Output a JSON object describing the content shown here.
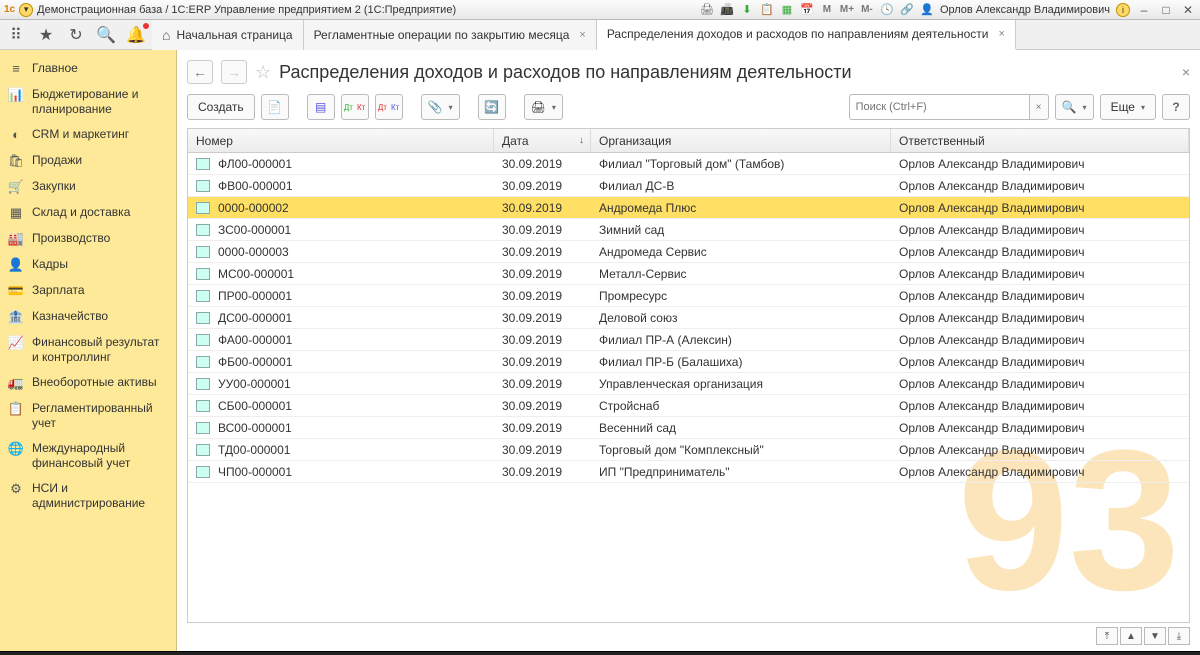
{
  "titlebar": {
    "app_title": "Демонстрационная база / 1С:ERP Управление предприятием 2  (1С:Предприятие)",
    "user": "Орлов Александр Владимирович"
  },
  "tabs": {
    "home": "Начальная страница",
    "tab1": "Регламентные операции по закрытию месяца",
    "tab2": "Распределения доходов и расходов по направлениям деятельности"
  },
  "sidebar": {
    "items": [
      {
        "icon": "≡",
        "label": "Главное"
      },
      {
        "icon": "📊",
        "label": "Бюджетирование и планирование"
      },
      {
        "icon": "◐",
        "label": "CRM и маркетинг"
      },
      {
        "icon": "🛍",
        "label": "Продажи"
      },
      {
        "icon": "🛒",
        "label": "Закупки"
      },
      {
        "icon": "▦",
        "label": "Склад и доставка"
      },
      {
        "icon": "🏭",
        "label": "Производство"
      },
      {
        "icon": "👤",
        "label": "Кадры"
      },
      {
        "icon": "💳",
        "label": "Зарплата"
      },
      {
        "icon": "🏦",
        "label": "Казначейство"
      },
      {
        "icon": "📈",
        "label": "Финансовый результат и контроллинг"
      },
      {
        "icon": "🚛",
        "label": "Внеоборотные активы"
      },
      {
        "icon": "📋",
        "label": "Регламентированный учет"
      },
      {
        "icon": "🌐",
        "label": "Международный финансовый учет"
      },
      {
        "icon": "⚙",
        "label": "НСИ и администрирование"
      }
    ]
  },
  "page": {
    "title": "Распределения доходов и расходов по направлениям деятельности",
    "create_btn": "Создать",
    "more_btn": "Еще",
    "search_placeholder": "Поиск (Ctrl+F)"
  },
  "table": {
    "columns": {
      "num": "Номер",
      "date": "Дата",
      "org": "Организация",
      "resp": "Ответственный"
    },
    "rows": [
      {
        "num": "ФЛ00-000001",
        "date": "30.09.2019",
        "org": "Филиал \"Торговый дом\" (Тамбов)",
        "resp": "Орлов Александр Владимирович",
        "sel": false
      },
      {
        "num": "ФВ00-000001",
        "date": "30.09.2019",
        "org": "Филиал ДС-В",
        "resp": "Орлов Александр Владимирович",
        "sel": false
      },
      {
        "num": "0000-000002",
        "date": "30.09.2019",
        "org": "Андромеда Плюс",
        "resp": "Орлов Александр Владимирович",
        "sel": true
      },
      {
        "num": "ЗС00-000001",
        "date": "30.09.2019",
        "org": "Зимний сад",
        "resp": "Орлов Александр Владимирович",
        "sel": false
      },
      {
        "num": "0000-000003",
        "date": "30.09.2019",
        "org": "Андромеда Сервис",
        "resp": "Орлов Александр Владимирович",
        "sel": false
      },
      {
        "num": "МС00-000001",
        "date": "30.09.2019",
        "org": "Металл-Сервис",
        "resp": "Орлов Александр Владимирович",
        "sel": false
      },
      {
        "num": "ПР00-000001",
        "date": "30.09.2019",
        "org": "Промресурс",
        "resp": "Орлов Александр Владимирович",
        "sel": false
      },
      {
        "num": "ДС00-000001",
        "date": "30.09.2019",
        "org": "Деловой союз",
        "resp": "Орлов Александр Владимирович",
        "sel": false
      },
      {
        "num": "ФА00-000001",
        "date": "30.09.2019",
        "org": "Филиал ПР-А (Алексин)",
        "resp": "Орлов Александр Владимирович",
        "sel": false
      },
      {
        "num": "ФБ00-000001",
        "date": "30.09.2019",
        "org": "Филиал ПР-Б (Балашиха)",
        "resp": "Орлов Александр Владимирович",
        "sel": false
      },
      {
        "num": "УУ00-000001",
        "date": "30.09.2019",
        "org": "Управленческая организация",
        "resp": "Орлов Александр Владимирович",
        "sel": false
      },
      {
        "num": "СБ00-000001",
        "date": "30.09.2019",
        "org": "Стройснаб",
        "resp": "Орлов Александр Владимирович",
        "sel": false
      },
      {
        "num": "ВС00-000001",
        "date": "30.09.2019",
        "org": "Весенний сад",
        "resp": "Орлов Александр Владимирович",
        "sel": false
      },
      {
        "num": "ТД00-000001",
        "date": "30.09.2019",
        "org": "Торговый дом \"Комплексный\"",
        "resp": "Орлов Александр Владимирович",
        "sel": false
      },
      {
        "num": "ЧП00-000001",
        "date": "30.09.2019",
        "org": "ИП \"Предприниматель\"",
        "resp": "Орлов Александр Владимирович",
        "sel": false
      }
    ]
  }
}
